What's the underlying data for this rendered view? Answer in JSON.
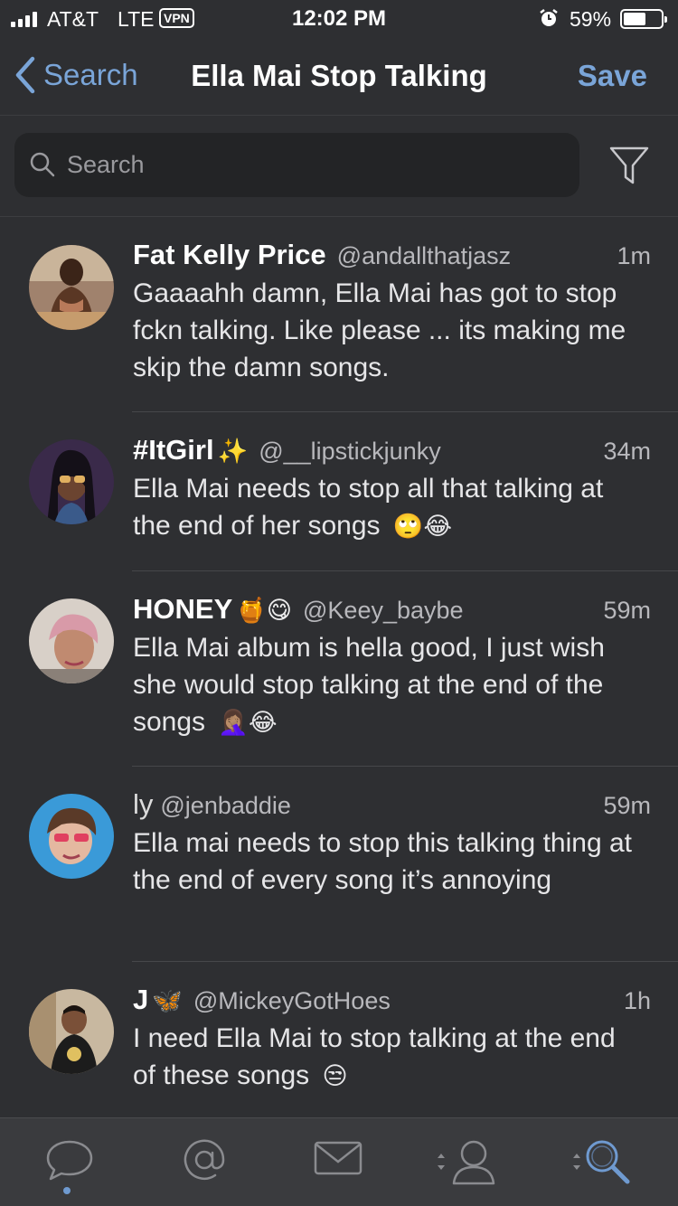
{
  "status_bar": {
    "carrier": "AT&T",
    "network": "LTE",
    "vpn": "VPN",
    "time": "12:02 PM",
    "alarm_icon": "alarm-clock-icon",
    "battery_percent": "59%",
    "battery_level": 0.59
  },
  "nav": {
    "back_label": "Search",
    "title": "Ella Mai Stop Talking",
    "save_label": "Save"
  },
  "search": {
    "placeholder": "Search",
    "value": ""
  },
  "tweets": [
    {
      "name": "Fat Kelly Price",
      "name_emoji": "",
      "handle": "@andallthatjasz",
      "time": "1m",
      "text": "Gaaaahh damn, Ella Mai has got to stop fckn talking. Like please ... its making me skip the damn songs.",
      "text_emoji": ""
    },
    {
      "name": "#ItGirl",
      "name_emoji": "✨",
      "handle": "@__lipstickjunky",
      "time": "34m",
      "text": "Ella Mai needs to stop all that talking at the end of her songs",
      "text_emoji": "🙄😂"
    },
    {
      "name": "HONEY",
      "name_emoji": "🍯😋",
      "handle": "@Keey_baybe",
      "time": "59m",
      "text": "Ella Mai album is hella good, I just wish she would stop talking at the end of the songs",
      "text_emoji": "🤦🏽‍♀️😂"
    },
    {
      "name": "ly",
      "name_emoji": "",
      "handle": "@jenbaddie",
      "time": "59m",
      "text": "Ella mai needs to stop this talking thing at the end of every song it’s annoying",
      "text_emoji": ""
    },
    {
      "name": "J",
      "name_emoji": "🦋",
      "handle": "@MickeyGotHoes",
      "time": "1h",
      "text": "I need Ella Mai to stop talking at the end of these songs",
      "text_emoji": "😒"
    }
  ],
  "tabbar": {
    "tabs": [
      "chat-bubble-icon",
      "at-mentions-icon",
      "messages-envelope-icon",
      "profile-icon",
      "search-magnifier-icon"
    ],
    "active": "search-magnifier-icon",
    "active_color": "#6f9ad0"
  },
  "colors": {
    "background": "#2e2f32",
    "accent": "#7aa5d8",
    "search_field": "#232426"
  }
}
